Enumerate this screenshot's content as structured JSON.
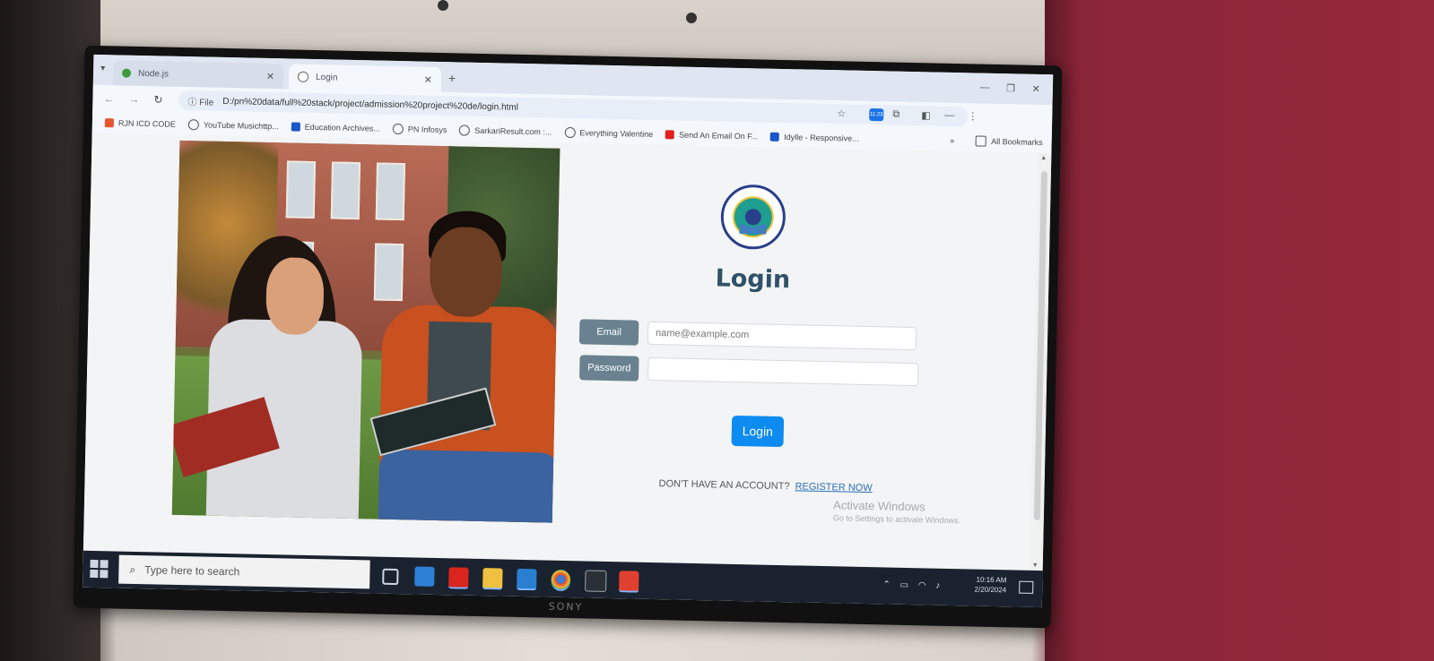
{
  "browser": {
    "tabs": [
      {
        "label": "Node.js",
        "active": false
      },
      {
        "label": "Login",
        "active": true
      }
    ],
    "address": {
      "scheme_label": "File",
      "url": "D:/pn%20data/full%20stack/project/admission%20project%20de/login.html"
    },
    "extension_badge": "11:23",
    "bookmarks": [
      {
        "label": "RJN ICD CODE",
        "icon_color": "#e8552d"
      },
      {
        "label": "YouTube Musichttp...",
        "icon_color": "#555555"
      },
      {
        "label": "Education Archives...",
        "icon_color": "#1a56c9"
      },
      {
        "label": "PN Infosys",
        "icon_color": "#555555"
      },
      {
        "label": "SarkariResult.com :...",
        "icon_color": "#555555"
      },
      {
        "label": "Everything Valentine",
        "icon_color": "#555555"
      },
      {
        "label": "Send An Email On F...",
        "icon_color": "#e0201c"
      },
      {
        "label": "Idylle - Responsive...",
        "icon_color": "#1a56c9"
      }
    ],
    "bookmarks_more": "»",
    "all_bookmarks": "All Bookmarks"
  },
  "login": {
    "title": "Login",
    "email_label": "Email",
    "email_placeholder": "name@example.com",
    "password_label": "Password",
    "submit_label": "Login",
    "register_prompt": "DON'T HAVE AN ACCOUNT?",
    "register_link": "REGISTER NOW"
  },
  "watermark": {
    "line1": "Activate Windows",
    "line2": "Go to Settings to activate Windows."
  },
  "taskbar": {
    "search_placeholder": "Type here to search",
    "time": "10:16 AM",
    "date": "2/20/2024"
  },
  "monitor": {
    "brand": "SONY"
  },
  "colors": {
    "accent": "#0d8bf0",
    "label_bg": "#6a8290",
    "title": "#2f5268"
  }
}
